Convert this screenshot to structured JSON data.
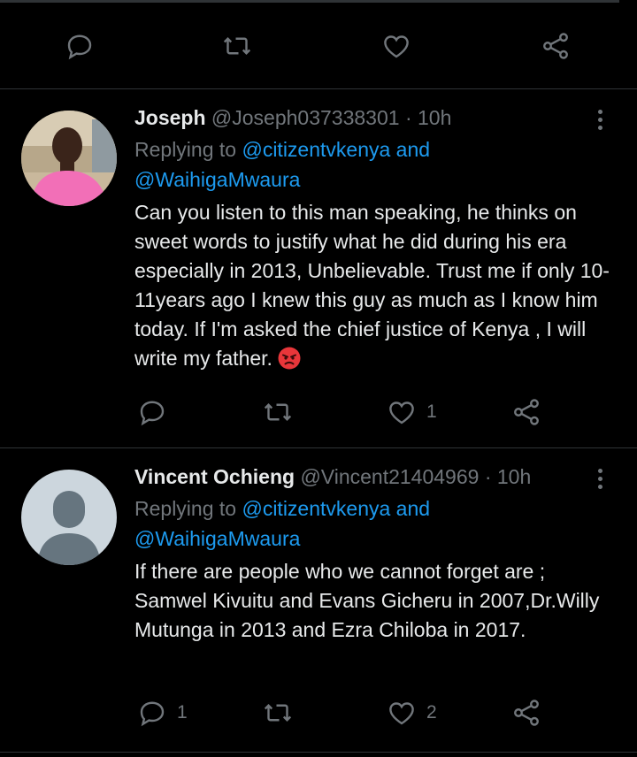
{
  "tweets": [
    {
      "name": "Joseph",
      "handle": "@Joseph037338301",
      "time": "· 10h",
      "replying_prefix": "Replying to ",
      "reply_to_1": "@citizentvkenya",
      "reply_and": " and",
      "reply_to_2": "@WaihigaMwaura",
      "text": "Can you listen to this man speaking, he thinks on sweet words to justify what he did during his era especially in 2013, Unbelievable. Trust me if only 10-11years ago I knew this guy as much as I know him today. If I'm asked the chief justice of Kenya , I will write my father.",
      "emoji": "angry-face-emoji",
      "reply_count": "",
      "like_count": "1"
    },
    {
      "name": "Vincent Ochieng",
      "handle": "@Vincent21404969",
      "time": "· 10h",
      "replying_prefix": "Replying to ",
      "reply_to_1": "@citizentvkenya",
      "reply_and": " and",
      "reply_to_2": "@WaihigaMwaura",
      "text": "If there are people who we cannot forget are ; Samwel Kivuitu and Evans Gicheru in 2007,Dr.Willy Mutunga in 2013 and Ezra Chiloba in 2017.",
      "reply_count": "1",
      "like_count": "2"
    }
  ],
  "colors": {
    "background": "#000000",
    "text": "#e7e9ea",
    "muted": "#71767b",
    "link": "#1d9bf0",
    "divider": "#2f3336"
  },
  "icons": [
    "reply-icon",
    "retweet-icon",
    "like-icon",
    "share-icon",
    "more-options-icon"
  ]
}
